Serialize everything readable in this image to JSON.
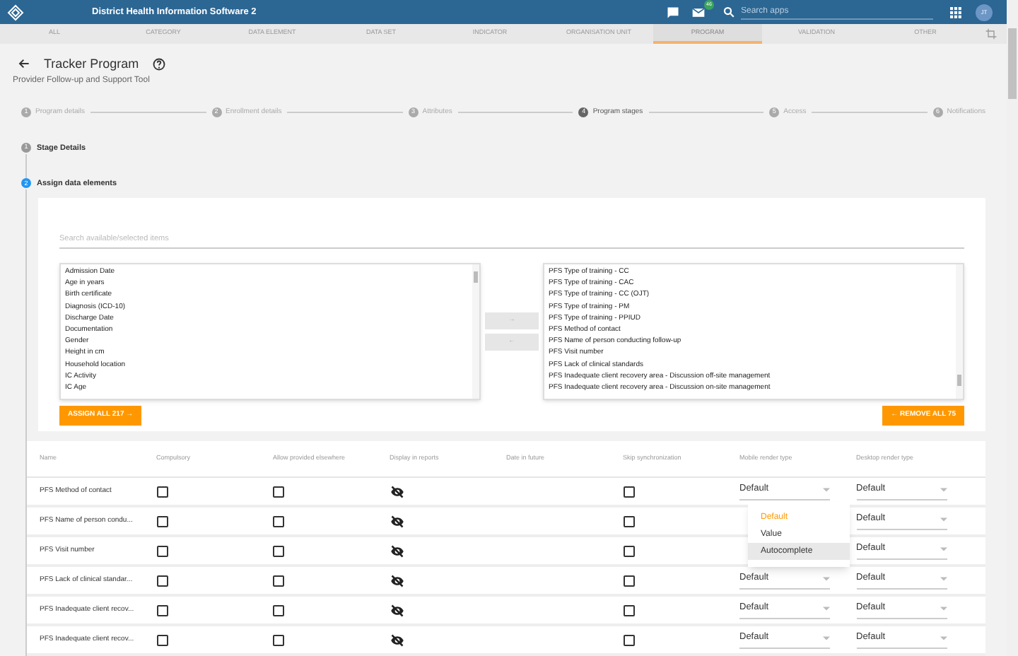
{
  "header": {
    "title": "District Health Information Software 2",
    "mail_badge": "46",
    "search_placeholder": "Search apps",
    "avatar": "JT"
  },
  "tabs": [
    {
      "label": "ALL",
      "selected": false
    },
    {
      "label": "CATEGORY",
      "selected": false
    },
    {
      "label": "DATA ELEMENT",
      "selected": false
    },
    {
      "label": "DATA SET",
      "selected": false
    },
    {
      "label": "INDICATOR",
      "selected": false
    },
    {
      "label": "ORGANISATION UNIT",
      "selected": false
    },
    {
      "label": "PROGRAM",
      "selected": true
    },
    {
      "label": "VALIDATION",
      "selected": false
    },
    {
      "label": "OTHER",
      "selected": false
    }
  ],
  "page": {
    "title": "Tracker Program",
    "subtitle": "Provider Follow-up and Support Tool"
  },
  "steps": [
    {
      "number": "1",
      "label": "Program details",
      "selected": false
    },
    {
      "number": "2",
      "label": "Enrollment details",
      "selected": false
    },
    {
      "number": "3",
      "label": "Attributes",
      "selected": false
    },
    {
      "number": "4",
      "label": "Program stages",
      "selected": true
    },
    {
      "number": "5",
      "label": "Access",
      "selected": false
    },
    {
      "number": "6",
      "label": "Notifications",
      "selected": false
    }
  ],
  "stage_steps": [
    {
      "number": "1",
      "label": "Stage Details",
      "selected": false
    },
    {
      "number": "2",
      "label": "Assign data elements",
      "selected": true
    }
  ],
  "assign": {
    "search_placeholder": "Search available/selected items",
    "available": [
      "Admission Date",
      "Age in years",
      "Birth certificate",
      "Diagnosis (ICD-10)",
      "Discharge Date",
      "Documentation",
      "Gender",
      "Height in cm",
      "Household location",
      "IC Activity",
      "IC Age"
    ],
    "selected": [
      "PFS Type of training - CC",
      "PFS Type of training - CAC",
      "PFS Type of training - CC (OJT)",
      "PFS Type of training - PM",
      "PFS Type of training - PPIUD",
      "PFS Method of contact",
      "PFS Name of person conducting follow-up",
      "PFS Visit number",
      "PFS Lack of clinical standards",
      "PFS Inadequate client recovery area - Discussion off-site management",
      "PFS Inadequate client recovery area - Discussion on-site management"
    ],
    "move_right": "→",
    "move_left": "←",
    "assign_all": "ASSIGN ALL 217 →",
    "remove_all": "← REMOVE ALL 75"
  },
  "table": {
    "columns": [
      "Name",
      "Compulsory",
      "Allow provided elsewhere",
      "Display in reports",
      "Date in future",
      "Skip synchronization",
      "Mobile render type",
      "Desktop render type"
    ],
    "rows": [
      {
        "name": "PFS Method of contact",
        "compulsory": false,
        "allow_provided_elsewhere": false,
        "display_in_reports": false,
        "skip_synchronization": false,
        "mobile_render": "Default",
        "desktop_render": "Default"
      },
      {
        "name": "PFS Name of person condu...",
        "compulsory": false,
        "allow_provided_elsewhere": false,
        "display_in_reports": false,
        "skip_synchronization": false,
        "desktop_render": "Default"
      },
      {
        "name": "PFS Visit number",
        "compulsory": false,
        "allow_provided_elsewhere": false,
        "display_in_reports": false,
        "skip_synchronization": false,
        "desktop_render": "Default"
      },
      {
        "name": "PFS Lack of clinical standar...",
        "compulsory": false,
        "allow_provided_elsewhere": false,
        "display_in_reports": false,
        "skip_synchronization": false,
        "mobile_render": "Default",
        "desktop_render": "Default"
      },
      {
        "name": "PFS Inadequate client recov...",
        "compulsory": false,
        "allow_provided_elsewhere": false,
        "display_in_reports": false,
        "skip_synchronization": false,
        "mobile_render": "Default",
        "desktop_render": "Default"
      },
      {
        "name": "PFS Inadequate client recov...",
        "compulsory": false,
        "allow_provided_elsewhere": false,
        "display_in_reports": false,
        "skip_synchronization": false,
        "mobile_render": "Default",
        "desktop_render": "Default"
      }
    ],
    "mobile_menu": [
      {
        "label": "Default",
        "selected": true,
        "highlighted": false
      },
      {
        "label": "Value",
        "selected": false,
        "highlighted": false
      },
      {
        "label": "Autocomplete",
        "selected": false,
        "highlighted": true
      }
    ]
  }
}
